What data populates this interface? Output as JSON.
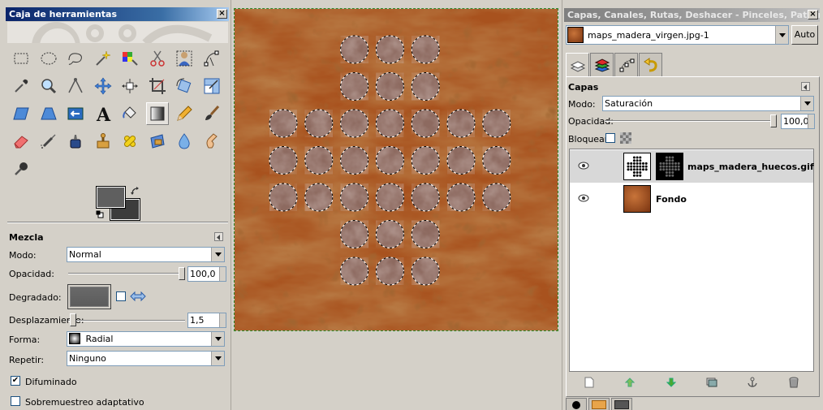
{
  "toolbox": {
    "title": "Caja de herramientas",
    "tools": [
      "rect-select-icon",
      "ellipse-select-icon",
      "free-select-icon",
      "fuzzy-select-icon",
      "select-by-color-icon",
      "scissors-select-icon",
      "foreground-select-icon",
      "paths-icon",
      "color-picker-icon",
      "zoom-icon",
      "measure-icon",
      "move-icon",
      "align-icon",
      "crop-icon",
      "rotate-icon",
      "scale-icon",
      "shear-icon",
      "perspective-icon",
      "flip-icon",
      "text-icon",
      "bucket-fill-icon",
      "blend-icon",
      "pencil-icon",
      "paintbrush-icon",
      "eraser-icon",
      "airbrush-icon",
      "ink-icon",
      "clone-icon",
      "heal-icon",
      "perspective-clone-icon",
      "blur-icon",
      "smudge-icon",
      "dodge-burn-icon"
    ],
    "active_tool_index": 21,
    "fg_color": "#5f5f5f",
    "bg_color": "#3c3c3c"
  },
  "tool_options": {
    "title": "Mezcla",
    "mode_label": "Modo:",
    "mode_value": "Normal",
    "opacity_label": "Opacidad:",
    "opacity_value": "100,0",
    "opacity_fraction": 1.0,
    "gradient_label": "Degradado:",
    "offset_label": "Desplazamiento:",
    "offset_value": "1,5",
    "offset_fraction": 0.015,
    "shape_label": "Forma:",
    "shape_value": "Radial",
    "repeat_label": "Repetir:",
    "repeat_value": "Ninguno",
    "dither_label": "Difuminado",
    "dither_checked": true,
    "supersample_label": "Sobremuestreo adaptativo",
    "supersample_checked": false
  },
  "dock": {
    "title": "Capas, Canales, Rutas, Deshacer - Pinceles, Patron...",
    "image_name": "maps_madera_virgen.jpg-1",
    "auto_label": "Auto",
    "tabs": [
      "layers-tab-icon",
      "channels-tab-icon",
      "paths-tab-icon",
      "undo-tab-icon"
    ],
    "layers_title": "Capas",
    "mode_label": "Modo:",
    "mode_value": "Saturación",
    "opacity_label": "Opacidad:",
    "opacity_value": "100,0",
    "opacity_fraction": 1.0,
    "lock_label": "Bloquear:",
    "layers": [
      {
        "name": "maps_madera_huecos.gif",
        "selected": true,
        "has_mask": true
      },
      {
        "name": "Fondo",
        "selected": false,
        "has_mask": false
      }
    ],
    "layer_actions": [
      "new-layer-icon",
      "raise-layer-icon",
      "lower-layer-icon",
      "duplicate-layer-icon",
      "anchor-layer-icon",
      "delete-layer-icon"
    ]
  },
  "colors": {
    "wood_dark": "#7a3410",
    "wood_mid": "#a8521e",
    "wood_light": "#c8743a",
    "hole_fill": "#8d6a60",
    "selection_border": "#2e8b2e"
  }
}
